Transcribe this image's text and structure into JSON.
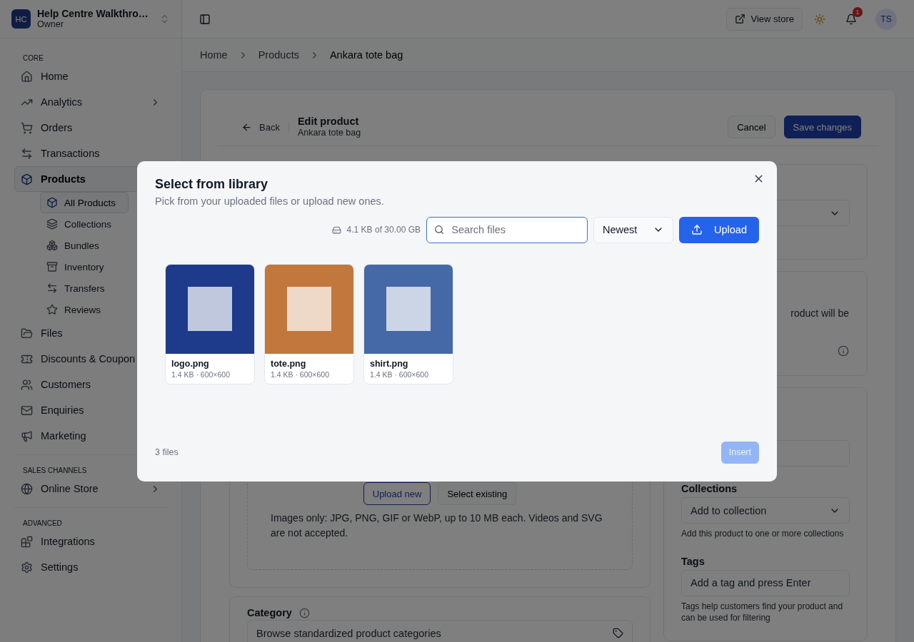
{
  "sidebar": {
    "workspace": {
      "initials": "HC",
      "name": "Help Centre Walkthro…",
      "role": "Owner"
    },
    "sections": [
      {
        "label": "CORE",
        "items": [
          {
            "label": "Home",
            "selected": false
          },
          {
            "label": "Analytics",
            "selected": false,
            "expanded": false
          },
          {
            "label": "Orders",
            "selected": false
          },
          {
            "label": "Transactions",
            "selected": false
          },
          {
            "label": "Products",
            "selected": true,
            "expanded": true,
            "children": [
              {
                "label": "All Products",
                "selected": true
              },
              {
                "label": "Collections",
                "selected": false
              },
              {
                "label": "Bundles",
                "selected": false
              },
              {
                "label": "Inventory",
                "selected": false
              },
              {
                "label": "Transfers",
                "selected": false
              },
              {
                "label": "Reviews",
                "selected": false
              }
            ]
          },
          {
            "label": "Files",
            "selected": false
          },
          {
            "label": "Discounts & Coupon",
            "selected": false
          },
          {
            "label": "Customers",
            "selected": false
          },
          {
            "label": "Enquiries",
            "selected": false
          },
          {
            "label": "Marketing",
            "selected": false
          }
        ]
      },
      {
        "label": "SALES CHANNELS",
        "items": [
          {
            "label": "Online Store",
            "selected": false,
            "expanded": false
          }
        ]
      },
      {
        "label": "ADVANCED",
        "items": [
          {
            "label": "Integrations",
            "selected": false
          },
          {
            "label": "Settings",
            "selected": false
          }
        ]
      }
    ]
  },
  "header": {
    "view_store": "View store",
    "notifications": "1",
    "avatar": "TS"
  },
  "breadcrumb": [
    {
      "label": "Home",
      "current": false
    },
    {
      "label": "Products",
      "current": false
    },
    {
      "label": "Ankara tote bag",
      "current": true
    }
  ],
  "editor": {
    "back": "Back",
    "title": "Edit product",
    "subtitle": "Ankara tote bag",
    "cancel": "Cancel",
    "save": "Save changes",
    "media": {
      "upload_new": "Upload new",
      "select_existing": "Select existing",
      "hint": "Images only: JPG, PNG, GIF or WebP, up to 10 MB each. Videos and SVG are not accepted."
    },
    "category": {
      "label": "Category",
      "placeholder": "Browse standardized product categories"
    },
    "status": {
      "text": "roduct will be"
    },
    "organization": {
      "collections_label": "Collections",
      "collections_placeholder": "Add to collection",
      "collections_help": "Add this product to one or more collections",
      "tags_label": "Tags",
      "tags_placeholder": "Add a tag and press Enter",
      "tags_help": "Tags help customers find your product and can be used for filtering"
    }
  },
  "modal": {
    "title": "Select from library",
    "subtitle": "Pick from your uploaded files or upload new ones.",
    "storage": "4.1 KB of 30.00 GB",
    "search_placeholder": "Search files",
    "sort": "Newest",
    "upload": "Upload",
    "files": [
      {
        "name": "logo.png",
        "meta": "1.4 KB · 600×600",
        "color": "#1e3a8a",
        "selected": false
      },
      {
        "name": "tote.png",
        "meta": "1.4 KB · 600×600",
        "color": "#c2773d",
        "selected": false
      },
      {
        "name": "shirt.png",
        "meta": "1.4 KB · 600×600",
        "color": "#4569a6",
        "selected": false
      }
    ],
    "count": "3 files",
    "insert": {
      "label": "Insert",
      "disabled": true
    }
  }
}
